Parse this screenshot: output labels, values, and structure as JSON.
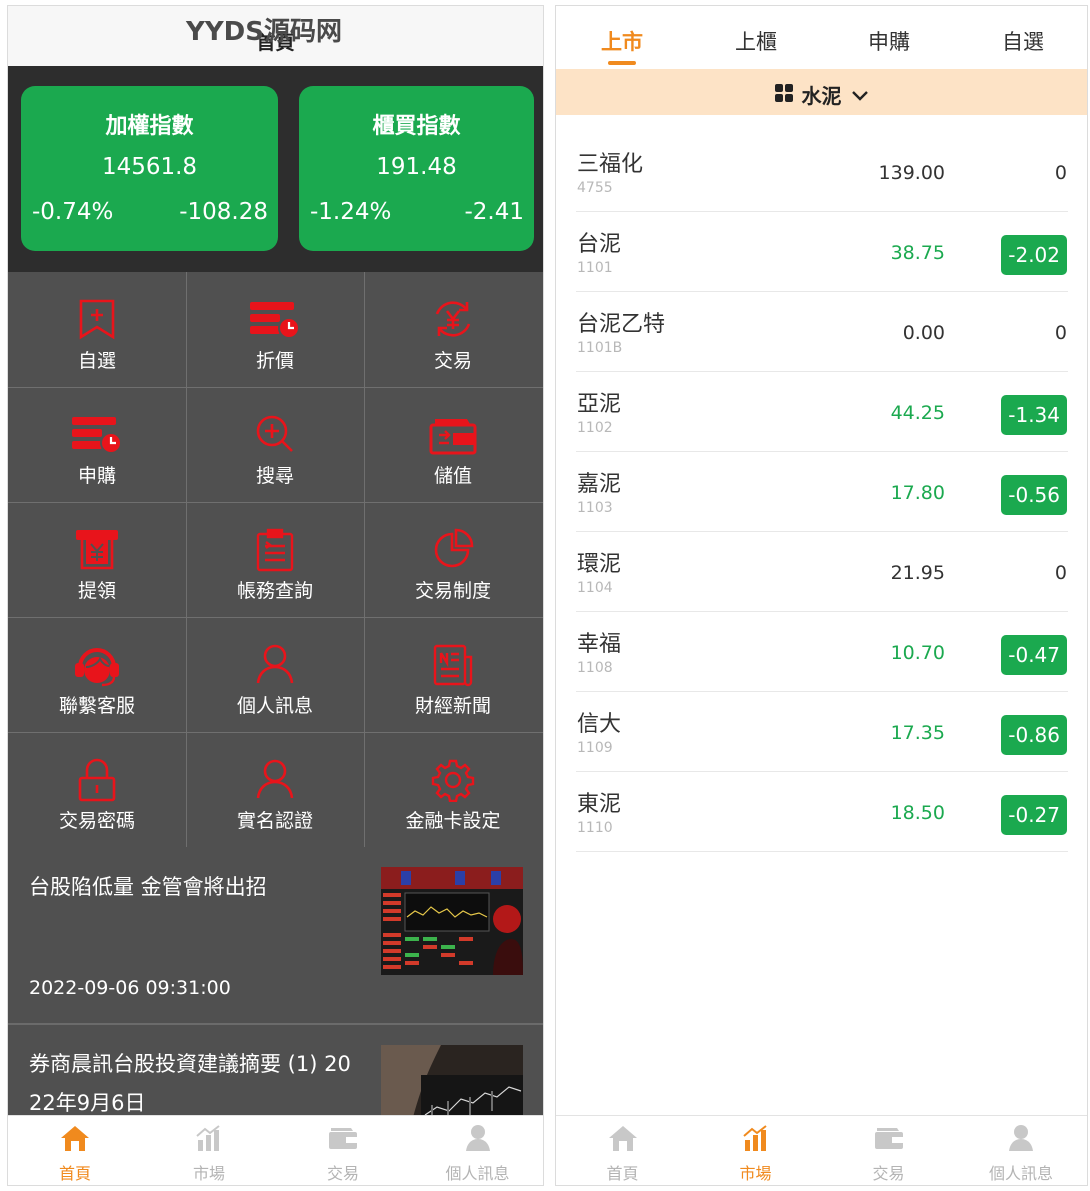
{
  "left": {
    "watermark": "YYDS源码网",
    "title": "首頁",
    "indices": [
      {
        "name": "加權指數",
        "value": "14561.8",
        "pct": "-0.74%",
        "change": "-108.28"
      },
      {
        "name": "櫃買指數",
        "value": "191.48",
        "pct": "-1.24%",
        "change": "-2.41"
      }
    ],
    "grid": [
      {
        "label": "自選",
        "icon": "bookmark-plus-icon"
      },
      {
        "label": "折價",
        "icon": "discount-icon"
      },
      {
        "label": "交易",
        "icon": "yen-exchange-icon"
      },
      {
        "label": "申購",
        "icon": "subscribe-icon"
      },
      {
        "label": "搜尋",
        "icon": "search-icon"
      },
      {
        "label": "儲值",
        "icon": "wallet-icon"
      },
      {
        "label": "提領",
        "icon": "withdraw-icon"
      },
      {
        "label": "帳務查詢",
        "icon": "clipboard-icon"
      },
      {
        "label": "交易制度",
        "icon": "pie-icon"
      },
      {
        "label": "聯繫客服",
        "icon": "headset-icon"
      },
      {
        "label": "個人訊息",
        "icon": "user-icon"
      },
      {
        "label": "財經新聞",
        "icon": "news-icon"
      },
      {
        "label": "交易密碼",
        "icon": "lock-icon"
      },
      {
        "label": "實名認證",
        "icon": "verified-user-icon"
      },
      {
        "label": "金融卡設定",
        "icon": "gear-icon"
      }
    ],
    "news": [
      {
        "title": "台股陷低量 金管會將出招",
        "time": "2022-09-06 09:31:00"
      },
      {
        "title_line1": "券商晨訊台股投資建議摘要 (1) 20",
        "title_line2": "22年9月6日"
      }
    ],
    "tabs": [
      "首頁",
      "市場",
      "交易",
      "個人訊息"
    ],
    "active_tab": 0
  },
  "right": {
    "segments": [
      "上市",
      "上櫃",
      "申購",
      "自選"
    ],
    "active_segment": 0,
    "filter_label": "水泥",
    "stocks": [
      {
        "name": "三福化",
        "code": "4755",
        "price": "139.00",
        "change": "0",
        "down": false
      },
      {
        "name": "台泥",
        "code": "1101",
        "price": "38.75",
        "change": "-2.02",
        "down": true
      },
      {
        "name": "台泥乙特",
        "code": "1101B",
        "price": "0.00",
        "change": "0",
        "down": false
      },
      {
        "name": "亞泥",
        "code": "1102",
        "price": "44.25",
        "change": "-1.34",
        "down": true
      },
      {
        "name": "嘉泥",
        "code": "1103",
        "price": "17.80",
        "change": "-0.56",
        "down": true
      },
      {
        "name": "環泥",
        "code": "1104",
        "price": "21.95",
        "change": "0",
        "down": false
      },
      {
        "name": "幸福",
        "code": "1108",
        "price": "10.70",
        "change": "-0.47",
        "down": true
      },
      {
        "name": "信大",
        "code": "1109",
        "price": "17.35",
        "change": "-0.86",
        "down": true
      },
      {
        "name": "東泥",
        "code": "1110",
        "price": "18.50",
        "change": "-0.27",
        "down": true
      }
    ],
    "tabs": [
      "首頁",
      "市場",
      "交易",
      "個人訊息"
    ],
    "active_tab": 1
  },
  "colors": {
    "accent": "#f08a1e",
    "down_green": "#1ba94f",
    "icon_red": "#e8141b",
    "panel_gray": "#505050",
    "filter_bg": "#fde3c6"
  }
}
